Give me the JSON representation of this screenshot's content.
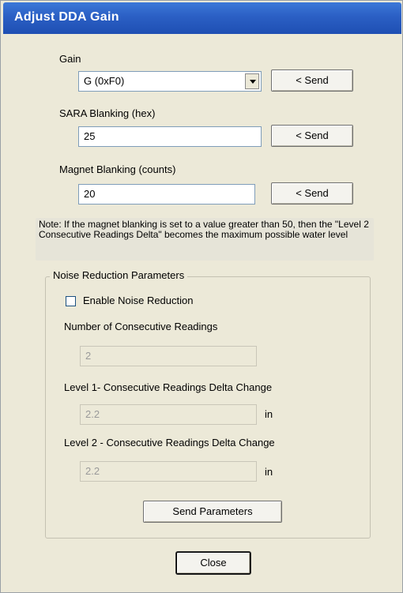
{
  "window": {
    "title": "Adjust DDA Gain"
  },
  "gain": {
    "label": "Gain",
    "value": "G (0xF0)",
    "send_label": "< Send"
  },
  "sara": {
    "label": "SARA Blanking (hex)",
    "value": "25",
    "send_label": "< Send"
  },
  "magnet": {
    "label": "Magnet Blanking (counts)",
    "value": "20",
    "send_label": "< Send"
  },
  "note": "Note: If the magnet blanking is set to a value greater than 50, then the \"Level 2 Consecutive Readings Delta\" becomes the maximum possible water level",
  "noise": {
    "group_title": "Noise Reduction Parameters",
    "enable_label": "Enable Noise Reduction",
    "enable_checked": false,
    "consecutive_label": "Number of Consecutive Readings",
    "consecutive_value": "2",
    "level1_label": "Level 1- Consecutive Readings Delta Change",
    "level1_value": "2.2",
    "level1_unit": "in",
    "level2_label": "Level 2 - Consecutive Readings Delta Change",
    "level2_value": "2.2",
    "level2_unit": "in",
    "send_params_label": "Send Parameters"
  },
  "close_label": "Close",
  "colors": {
    "title_bar": "#2b5fc4",
    "window_bg": "#ece9d8"
  }
}
